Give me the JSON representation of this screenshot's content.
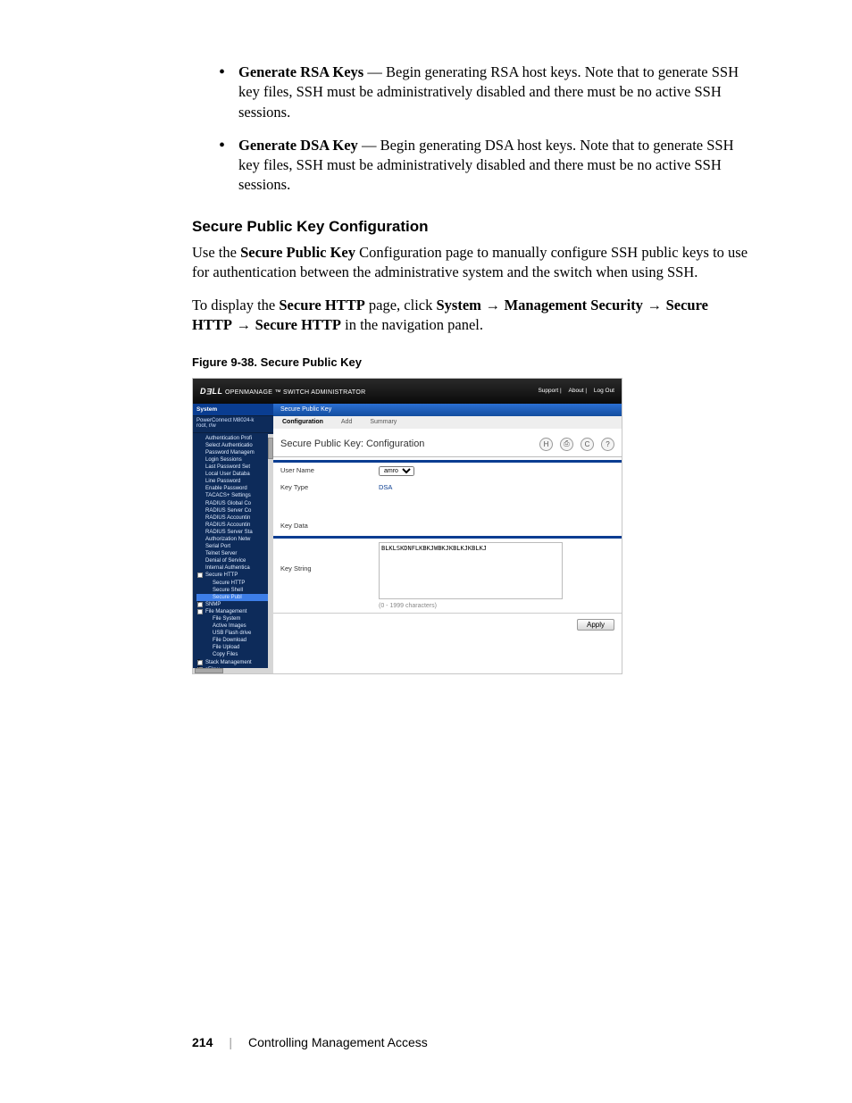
{
  "bullets": [
    {
      "term": "Generate RSA Keys",
      "rest": " — Begin generating RSA host keys. Note that to generate SSH key files, SSH must be administratively disabled and there must be no active SSH sessions."
    },
    {
      "term": "Generate DSA Key",
      "rest": " — Begin generating DSA host keys. Note that to generate SSH key files, SSH must be administratively disabled and there must be no active SSH sessions."
    }
  ],
  "section_heading": "Secure Public Key Configuration",
  "para1_pre": "Use the ",
  "para1_bold": "Secure Public Key",
  "para1_post": " Configuration page to manually configure SSH public keys to use for authentication between the administrative system and the switch when using SSH.",
  "para2": {
    "pre": "To display the ",
    "b1": "Secure HTTP",
    "mid1": " page, click ",
    "b2": "System",
    "arrow": " → ",
    "b3": "Management Security",
    "b4": "Secure HTTP",
    "b5": "Secure HTTP",
    "post": " in the navigation panel."
  },
  "figure_caption": "Figure 9-38.    Secure Public Key",
  "ui": {
    "brand": "DELL",
    "brand_sub": "  OPENMANAGE ™ SWITCH ADMINISTRATOR",
    "top_links": [
      "Support",
      "About",
      "Log Out"
    ],
    "side": {
      "header": "System",
      "sub1": "PowerConnect M8024-k",
      "sub2": "root, r/w",
      "tree": [
        {
          "t": "Authentication Profi",
          "icon": false
        },
        {
          "t": "Select Authenticatio",
          "icon": false
        },
        {
          "t": "Password Managem",
          "icon": false
        },
        {
          "t": "Login Sessions",
          "icon": false
        },
        {
          "t": "Last Password Set",
          "icon": false
        },
        {
          "t": "Local User Databa",
          "icon": false
        },
        {
          "t": "Line Password",
          "icon": false
        },
        {
          "t": "Enable Password",
          "icon": false
        },
        {
          "t": "TACACS+ Settings",
          "icon": false
        },
        {
          "t": "RADIUS Global Co",
          "icon": false
        },
        {
          "t": "RADIUS Server Co",
          "icon": false
        },
        {
          "t": "RADIUS Accountin",
          "icon": false
        },
        {
          "t": "RADIUS Accountin",
          "icon": false
        },
        {
          "t": "RADIUS Server Sta",
          "icon": false
        },
        {
          "t": "Authorization Netw",
          "icon": false
        },
        {
          "t": "Serial Port",
          "icon": false
        },
        {
          "t": "Telnet Server",
          "icon": false
        },
        {
          "t": "Denial of Service",
          "icon": false
        },
        {
          "t": "Internal Authentica",
          "icon": false
        },
        {
          "t": "Secure HTTP",
          "icon": true,
          "plus": false
        },
        {
          "t": "Secure HTTP",
          "icon": false,
          "indent": true
        },
        {
          "t": "Secure Shell",
          "icon": false,
          "indent": true
        },
        {
          "t": "Secure Publ",
          "icon": false,
          "indent": true,
          "sel": true
        },
        {
          "t": "SNMP",
          "icon": true,
          "plus": true
        },
        {
          "t": "File Management",
          "icon": true,
          "plus": false
        },
        {
          "t": "File System",
          "icon": false,
          "indent": true
        },
        {
          "t": "Active Images",
          "icon": false,
          "indent": true
        },
        {
          "t": "USB Flash drive",
          "icon": false,
          "indent": true
        },
        {
          "t": "File Download",
          "icon": false,
          "indent": true
        },
        {
          "t": "File Upload",
          "icon": false,
          "indent": true
        },
        {
          "t": "Copy Files",
          "icon": false,
          "indent": true
        },
        {
          "t": "Stack Management",
          "icon": true,
          "plus": true
        },
        {
          "t": "sFlow",
          "icon": true,
          "plus": true
        }
      ]
    },
    "tabs1": [
      "Secure Public Key"
    ],
    "tabs2": [
      "Configuration",
      "Add",
      "Summary"
    ],
    "page_title": "Secure Public Key: Configuration",
    "icon_glyphs": [
      "H",
      "⎙",
      "C",
      "?"
    ],
    "form": {
      "username_label": "User Name",
      "username_options": [
        "amro"
      ],
      "keytype_label": "Key Type",
      "keytype_value": "DSA",
      "keydata_label": "Key Data",
      "keystring_label": "Key String",
      "keystring_value": "BLKLSKDNFLKBKJWBKJKBLKJKBLKJ",
      "keystring_hint": "(0 - 1999 characters)"
    },
    "apply": "Apply"
  },
  "footer": {
    "page_num": "214",
    "chapter": "Controlling Management Access"
  }
}
